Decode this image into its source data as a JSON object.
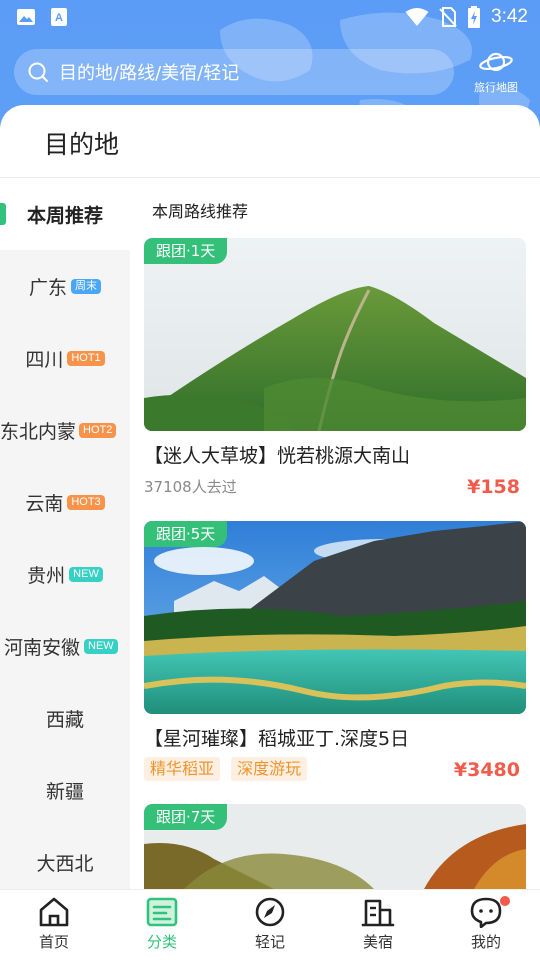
{
  "status_bar": {
    "time": "3:42"
  },
  "search": {
    "placeholder": "目的地/路线/美宿/轻记"
  },
  "travel_map": {
    "label": "旅行地图"
  },
  "page": {
    "title": "目的地",
    "section_title": "本周路线推荐"
  },
  "sidebar": {
    "items": [
      {
        "label": "本周推荐",
        "tag": ""
      },
      {
        "label": "广东",
        "tag": "周末",
        "tag_color": "#4aa6f6"
      },
      {
        "label": "四川",
        "tag": "HOT1",
        "tag_color": "#f7934b"
      },
      {
        "label": "东北内蒙",
        "tag": "HOT2",
        "tag_color": "#f7934b"
      },
      {
        "label": "云南",
        "tag": "HOT3",
        "tag_color": "#f7934b"
      },
      {
        "label": "贵州",
        "tag": "NEW",
        "tag_color": "#37d0c4"
      },
      {
        "label": "河南安徽",
        "tag": "NEW",
        "tag_color": "#37d0c4"
      },
      {
        "label": "西藏",
        "tag": ""
      },
      {
        "label": "新疆",
        "tag": ""
      },
      {
        "label": "大西北",
        "tag": ""
      }
    ]
  },
  "cards": [
    {
      "badge": "跟团·1天",
      "title": "【迷人大草坡】恍若桃源大南山",
      "visits": "37108人去过",
      "price": "¥158"
    },
    {
      "badge": "跟团·5天",
      "title": "【星河璀璨】稻城亚丁.深度5日",
      "tags": [
        "精华稻亚",
        "深度游玩"
      ],
      "price": "¥3480"
    },
    {
      "badge": "跟团·7天"
    }
  ],
  "bottom_nav": [
    {
      "label": "首页",
      "icon": "home-icon"
    },
    {
      "label": "分类",
      "icon": "category-icon",
      "active": true
    },
    {
      "label": "轻记",
      "icon": "compass-pen-icon"
    },
    {
      "label": "美宿",
      "icon": "building-icon"
    },
    {
      "label": "我的",
      "icon": "chat-face-icon",
      "badge_dot": true
    }
  ],
  "colors": {
    "accent": "#31c27c",
    "header": "#5b9cf6",
    "price": "#f25a4b",
    "tag_text": "#f0932b"
  }
}
